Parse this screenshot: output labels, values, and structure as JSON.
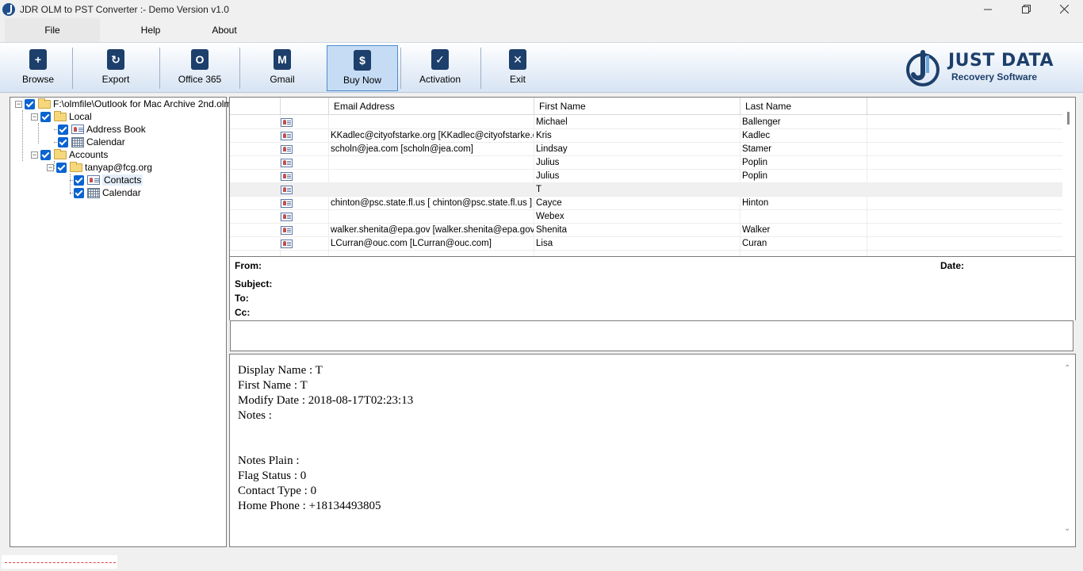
{
  "window": {
    "title": "JDR OLM to PST Converter :- Demo Version v1.0"
  },
  "menu": {
    "file": "File",
    "help": "Help",
    "about": "About"
  },
  "toolbar": {
    "browse": "Browse",
    "export": "Export",
    "office365": "Office 365",
    "gmail": "Gmail",
    "buy_now": "Buy Now",
    "activation": "Activation",
    "exit": "Exit"
  },
  "logo": {
    "title": "JUST DATA",
    "subtitle": "Recovery Software"
  },
  "tree": {
    "root": "F:\\olmfile\\Outlook for Mac Archive 2nd.olm",
    "local": "Local",
    "address_book": "Address Book",
    "calendar_local": "Calendar",
    "accounts": "Accounts",
    "account": "tanyap@fcg.org",
    "contacts": "Contacts",
    "calendar_account": "Calendar"
  },
  "grid": {
    "headers": [
      "Email Address",
      "First Name",
      "Last Name"
    ],
    "rows": [
      {
        "email": "",
        "first": "Michael",
        "last": "Ballenger"
      },
      {
        "email": "KKadlec@cityofstarke.org [KKadlec@cityofstarke.o...",
        "first": "Kris",
        "last": "Kadlec"
      },
      {
        "email": "scholn@jea.com [scholn@jea.com]",
        "first": "Lindsay",
        "last": "Stamer"
      },
      {
        "email": "",
        "first": "Julius",
        "last": "Poplin"
      },
      {
        "email": "",
        "first": "Julius",
        "last": "Poplin"
      },
      {
        "email": "",
        "first": "T",
        "last": ""
      },
      {
        "email": " chinton@psc.state.fl.us  [ chinton@psc.state.fl.us ]",
        "first": "Cayce",
        "last": "Hinton"
      },
      {
        "email": "",
        "first": "Webex",
        "last": ""
      },
      {
        "email": "walker.shenita@epa.gov [walker.shenita@epa.gov]",
        "first": "Shenita",
        "last": "Walker"
      },
      {
        "email": "LCurran@ouc.com [LCurran@ouc.com]",
        "first": "Lisa",
        "last": "Curan"
      }
    ],
    "selected_index": 5
  },
  "header_info": {
    "from": "From:",
    "date": "Date:",
    "subject": "Subject:",
    "to": "To:",
    "cc": "Cc:"
  },
  "details": {
    "lines": [
      "Display Name : T",
      "First Name : T",
      "Modify Date : 2018-08-17T02:23:13",
      "Notes :",
      "",
      "",
      "Notes Plain :",
      "Flag Status : 0",
      "Contact Type : 0",
      "Home Phone : +18134493805"
    ]
  },
  "colors": {
    "brand": "#1d3f6b",
    "checkbox": "#0a64d0"
  }
}
